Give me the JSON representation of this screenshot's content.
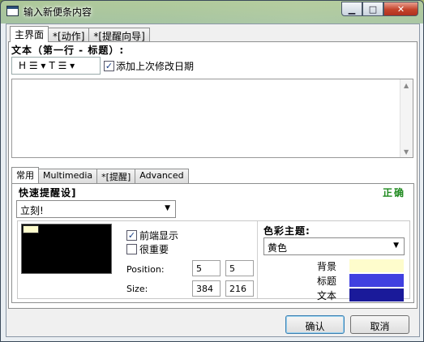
{
  "window": {
    "title": "输入新便条内容",
    "minimize_glyph": "▁",
    "maximize_glyph": "□",
    "close_glyph": "✕"
  },
  "main_tabs": [
    "主界面",
    "*[动作]",
    "*[提醒向导]"
  ],
  "text_section": {
    "label": "文本（第一行 - 标题）:",
    "toolbar": {
      "heading": "H ☰ ▾",
      "text": "T ☰ ▾"
    },
    "add_date_label": "添加上次修改日期",
    "add_date_checked": true
  },
  "inner_tabs": [
    "常用",
    "Multimedia",
    "*[提醒]",
    "Advanced"
  ],
  "quick": {
    "label": "快速提醒设]",
    "value": "立刻!",
    "status": "正确",
    "status_color": "#1f8a1f"
  },
  "display": {
    "topmost_label": "前端显示",
    "topmost_checked": true,
    "important_label": "很重要",
    "important_checked": false,
    "position_label": "Position:",
    "position_x": "5",
    "position_y": "5",
    "size_label": "Size:",
    "size_w": "384",
    "size_h": "216"
  },
  "theme": {
    "label": "色彩主题:",
    "value": "黄色",
    "colors": [
      {
        "label": "背景",
        "hex": "#fefccc"
      },
      {
        "label": "标题",
        "hex": "#4040e0"
      },
      {
        "label": "文本",
        "hex": "#1a1a9a"
      }
    ]
  },
  "buttons": {
    "ok": "确认",
    "cancel": "取消"
  }
}
